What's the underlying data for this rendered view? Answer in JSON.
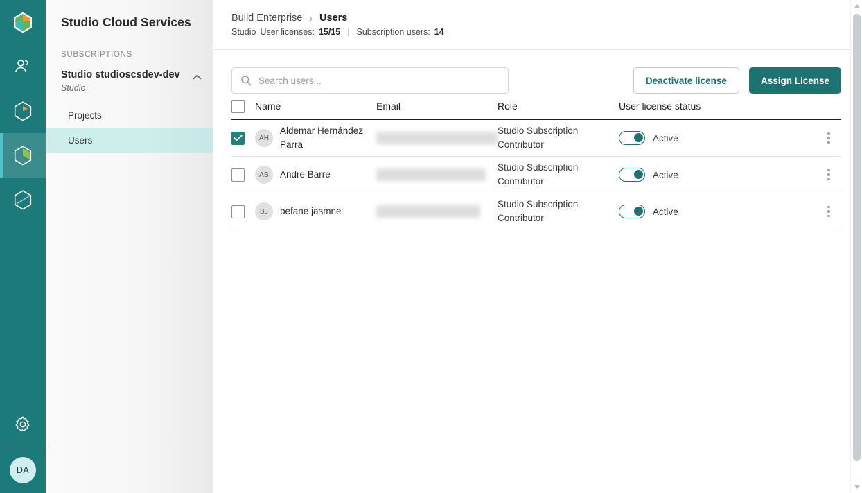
{
  "colors": {
    "rail_bg": "#1d7a7a",
    "rail_active": "#3b8c8c",
    "accent": "#1d7272",
    "selected_nav": "#cdeeea",
    "checkbox_checked": "#24807d"
  },
  "rail": {
    "items": [
      {
        "icon": "cube-logo-icon",
        "name": "app-logo",
        "active": false
      },
      {
        "icon": "users-icon",
        "name": "rail-item-users",
        "active": false
      },
      {
        "icon": "cube-orange-icon",
        "name": "rail-item-projects",
        "active": false
      },
      {
        "icon": "cube-green-icon",
        "name": "rail-item-cloud-services",
        "active": true
      },
      {
        "icon": "cube-outline-icon",
        "name": "rail-item-admin",
        "active": false
      }
    ],
    "settings_icon": "gear-icon",
    "avatar_initials": "DA"
  },
  "sidebar": {
    "title": "Studio Cloud Services",
    "section_label": "SUBSCRIPTIONS",
    "subscription": {
      "name": "Studio studioscsdev-dev",
      "kind": "Studio",
      "collapse_icon": "chevron-up-icon"
    },
    "nav": [
      {
        "label": "Projects",
        "selected": false
      },
      {
        "label": "Users",
        "selected": true
      }
    ]
  },
  "breadcrumb": {
    "parent": "Build Enterprise",
    "separator": "›",
    "current": "Users",
    "meta": {
      "product": "Studio",
      "licenses_label": "User licenses:",
      "licenses_value": "15/15",
      "pipe": "|",
      "subscription_users_label": "Subscription users:",
      "subscription_users_value": "14"
    }
  },
  "toolbar": {
    "search_placeholder": "Search users...",
    "search_value": "",
    "search_icon": "search-icon",
    "deactivate_label": "Deactivate license",
    "assign_label": "Assign License"
  },
  "table": {
    "columns": [
      "Name",
      "Email",
      "Role",
      "User license status"
    ],
    "select_all_checked": false,
    "rows": [
      {
        "checked": true,
        "initials": "AH",
        "name": "Aldemar Hernández Parra",
        "email_redacted": true,
        "email_width": 175,
        "role": "Studio Subscription Contributor",
        "status_on": true,
        "status_label": "Active",
        "menu_icon": "kebab-menu-icon"
      },
      {
        "checked": false,
        "initials": "AB",
        "name": "Andre Barre",
        "email_redacted": true,
        "email_width": 158,
        "role": "Studio Subscription Contributor",
        "status_on": true,
        "status_label": "Active",
        "menu_icon": "kebab-menu-icon"
      },
      {
        "checked": false,
        "initials": "BJ",
        "name": "befane jasmne",
        "email_redacted": true,
        "email_width": 150,
        "role": "Studio Subscription Contributor",
        "status_on": true,
        "status_label": "Active",
        "menu_icon": "kebab-menu-icon"
      }
    ]
  },
  "scrollbar": {
    "up_icon": "scroll-up-arrow-icon",
    "down_icon": "scroll-down-arrow-icon"
  }
}
